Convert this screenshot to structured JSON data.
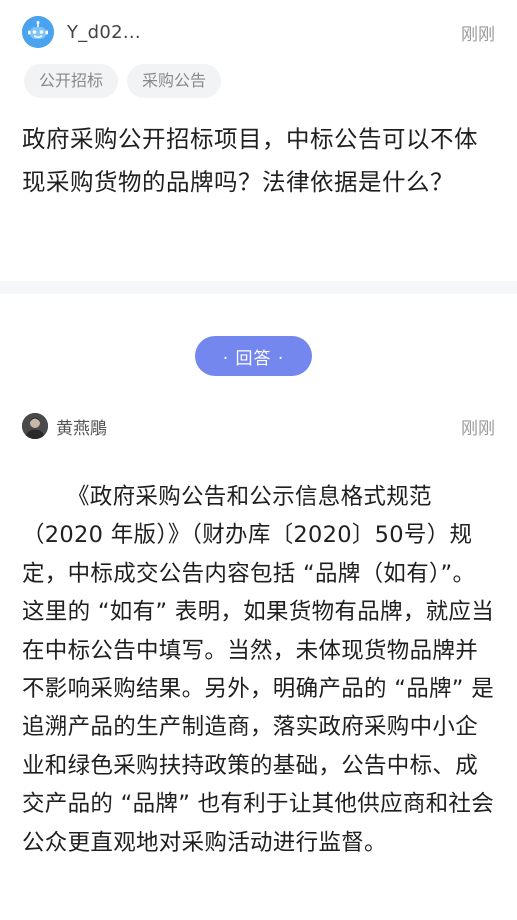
{
  "question": {
    "user": {
      "name": "Y_d02...",
      "avatar_icon": "robot-avatar-icon",
      "avatar_color": "#4aa3ef"
    },
    "time": "刚刚",
    "tags": [
      "公开招标",
      "采购公告"
    ],
    "text": "政府采购公开招标项目，中标公告可以不体现采购货物的品牌吗？法律依据是什么？"
  },
  "answer_button": {
    "label": "· 回答 ·",
    "color": "#7387ee"
  },
  "answer": {
    "user": {
      "name": "黄燕鵰",
      "avatar_icon": "person-photo-avatar"
    },
    "time": "刚刚",
    "text": "《政府采购公告和公示信息格式规范（2020 年版）》（财办库〔2020〕50号）规定，中标成交公告内容包括 “品牌（如有）”。这里的 “如有” 表明，如果货物有品牌，就应当在中标公告中填写。当然，未体现货物品牌并不影响采购结果。另外，明确产品的 “品牌” 是追溯产品的生产制造商，落实政府采购中小企业和绿色采购扶持政策的基础，公告中标、成交产品的 “品牌” 也有利于让其他供应商和社会公众更直观地对采购活动进行监督。"
  }
}
